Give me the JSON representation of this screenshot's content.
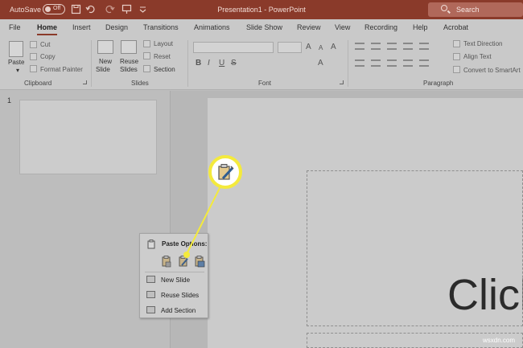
{
  "titlebar": {
    "autosave_label": "AutoSave",
    "autosave_state": "Off",
    "document_title": "Presentation1  -  PowerPoint",
    "search_placeholder": "Search"
  },
  "tabs": [
    "File",
    "Home",
    "Insert",
    "Design",
    "Transitions",
    "Animations",
    "Slide Show",
    "Review",
    "View",
    "Recording",
    "Help",
    "Acrobat"
  ],
  "active_tab": "Home",
  "ribbon": {
    "clipboard": {
      "paste": "Paste",
      "cut": "Cut",
      "copy": "Copy",
      "format_painter": "Format Painter",
      "group_label": "Clipboard"
    },
    "slides": {
      "new_slide_line1": "New",
      "new_slide_line2": "Slide",
      "reuse_line1": "Reuse",
      "reuse_line2": "Slides",
      "layout": "Layout",
      "reset": "Reset",
      "section": "Section",
      "group_label": "Slides"
    },
    "font": {
      "bold": "B",
      "italic": "I",
      "underline": "U",
      "strike": "S",
      "grow": "A",
      "shrink": "A",
      "clear": "A",
      "highlight": "A",
      "group_label": "Font"
    },
    "paragraph": {
      "text_direction": "Text Direction",
      "align_text": "Align Text",
      "smartart": "Convert to SmartArt",
      "group_label": "Paragraph"
    }
  },
  "slide_pane": {
    "slide_number": "1"
  },
  "slide": {
    "title_placeholder_text": "Click"
  },
  "context_menu": {
    "title": "Paste Options:",
    "items": [
      "New Slide",
      "Reuse Slides",
      "Add Section"
    ]
  },
  "callout_icon": "paste-keep-formatting-icon",
  "watermark": "wsxdn.com",
  "colors": {
    "titlebar": "#8a3a2a",
    "callout_ring": "#f4ea3c"
  }
}
